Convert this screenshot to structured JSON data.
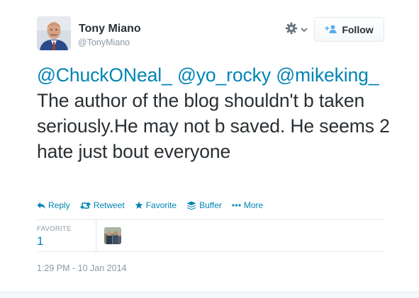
{
  "tweet": {
    "user": {
      "name": "Tony Miano",
      "handle": "@TonyMiano"
    },
    "follow_label": "Follow",
    "text": {
      "mention1": "@ChuckONeal_",
      "mention2": "@yo_rocky",
      "mention3": "@mikeking_",
      "body": " The author of the blog shouldn't b taken seriously.He may not b saved. He seems 2 hate just bout everyone"
    },
    "actions": [
      {
        "label": "Reply",
        "icon": "reply-icon"
      },
      {
        "label": "Retweet",
        "icon": "retweet-icon"
      },
      {
        "label": "Favorite",
        "icon": "star-icon"
      },
      {
        "label": "Buffer",
        "icon": "buffer-icon"
      },
      {
        "label": "More",
        "icon": "more-icon"
      }
    ],
    "stats": {
      "favorite_label": "FAVORITE",
      "favorite_count": "1"
    },
    "timestamp": "1:29 PM - 10 Jan 2014"
  },
  "colors": {
    "link": "#0084b4",
    "text": "#292f33",
    "muted": "#8899a6",
    "border": "#e1e8ed"
  }
}
